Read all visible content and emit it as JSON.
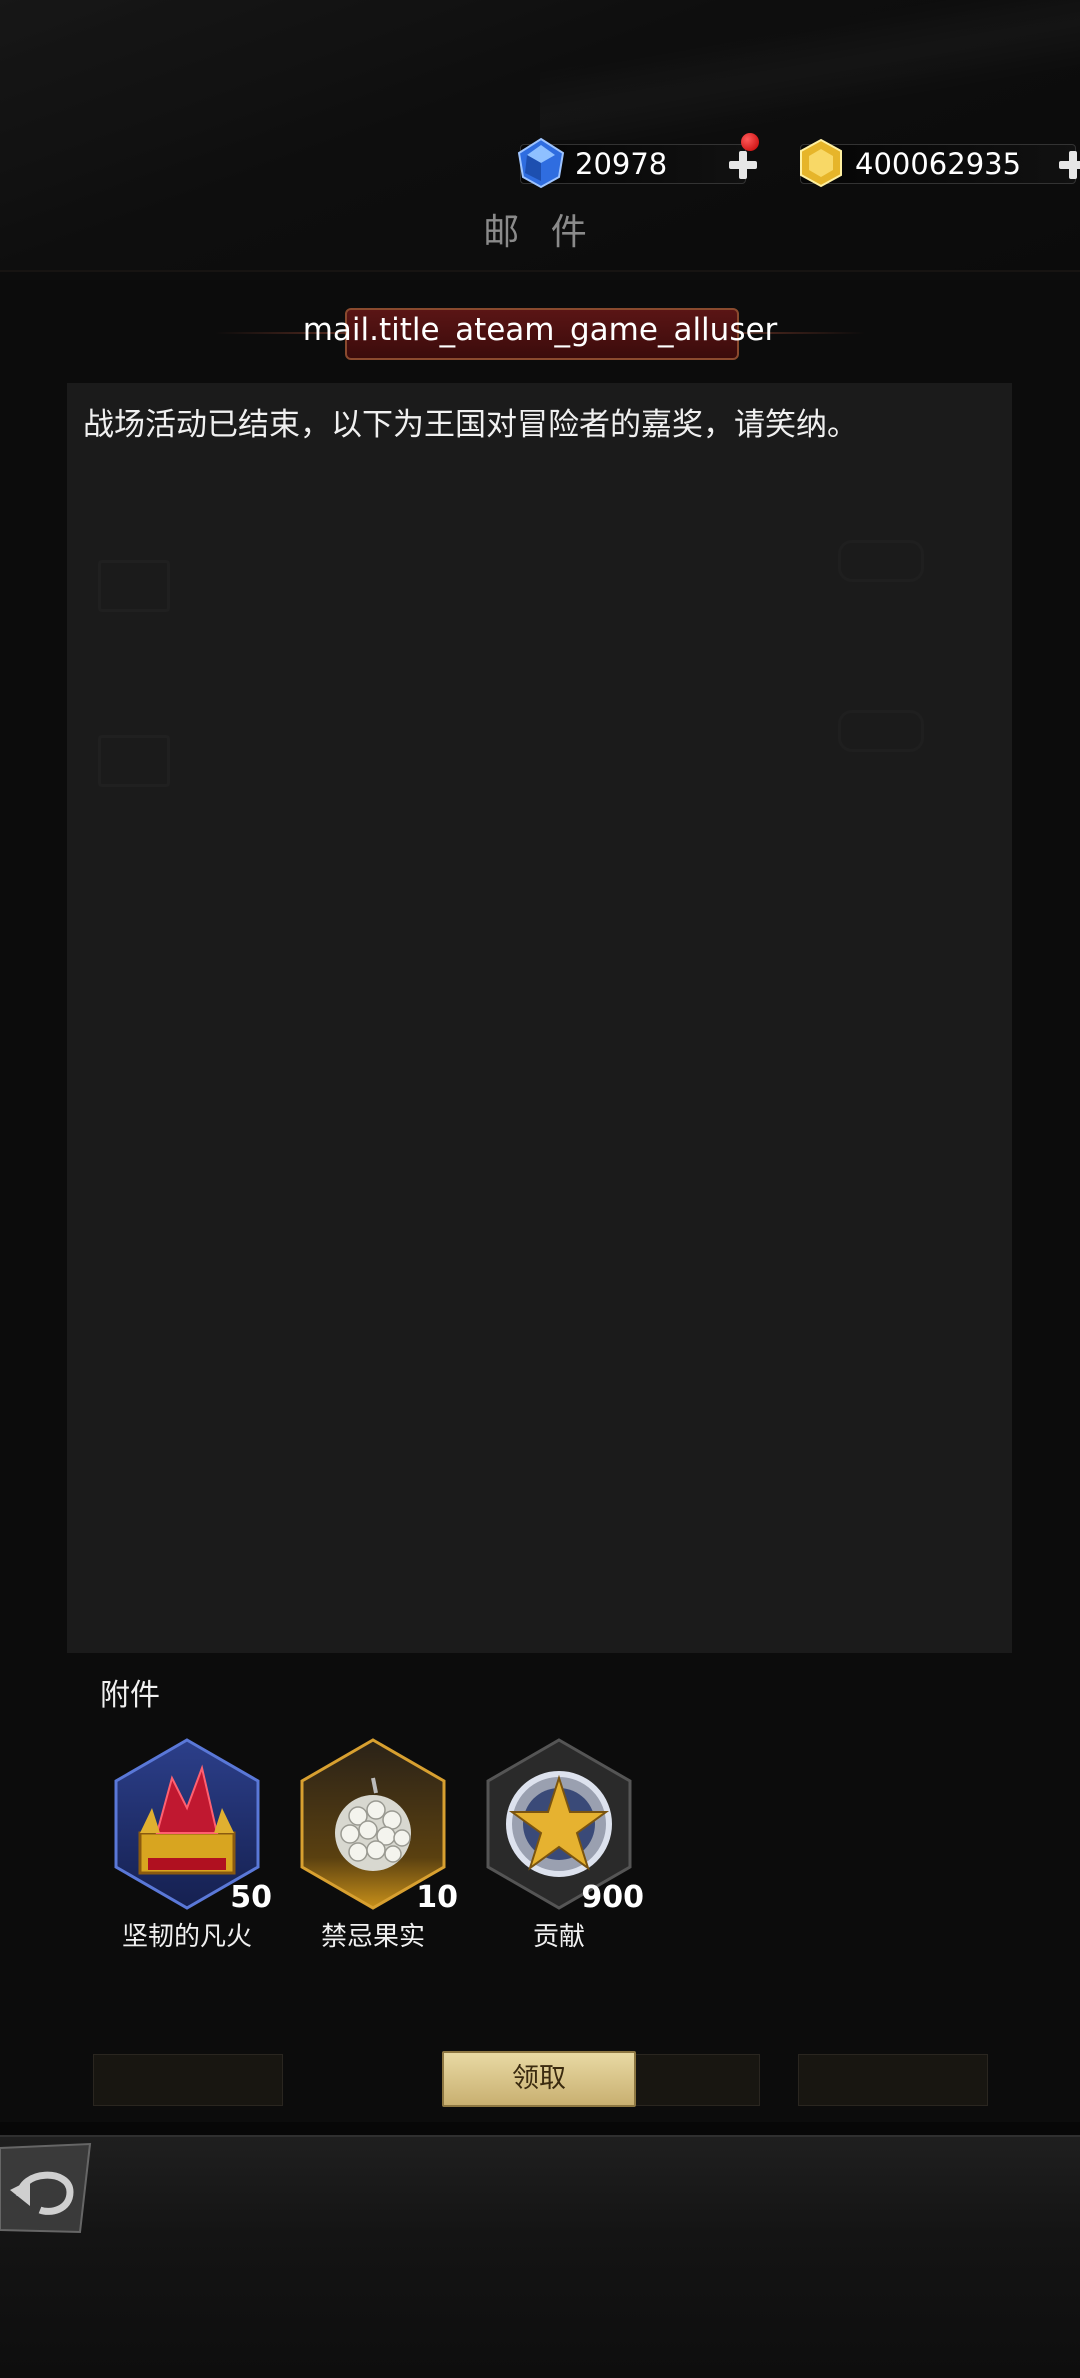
{
  "header": {
    "title": "邮 件",
    "currencies": [
      {
        "icon": "blue-diamond-icon",
        "value": "20978",
        "has_notification": true
      },
      {
        "icon": "gold-gem-icon",
        "value": "400062935",
        "has_notification": false
      }
    ]
  },
  "mail": {
    "title": "mail.title_ateam_game_alluser",
    "body": "战场活动已结束，以下为王国对冒险者的嘉奖，请笑纳。"
  },
  "attachments": {
    "label": "附件",
    "items": [
      {
        "icon": "red-crystal-chest-icon",
        "quantity": "50",
        "name": "坚韧的凡火"
      },
      {
        "icon": "white-fruit-icon",
        "quantity": "10",
        "name": "禁忌果实"
      },
      {
        "icon": "gold-star-medal-icon",
        "quantity": "900",
        "name": "贡献"
      }
    ]
  },
  "actions": {
    "claim_label": "领取"
  },
  "colors": {
    "panel_bg": "#1f1f1f",
    "claim_button": "#d9c48a",
    "title_plate": "#4a1010"
  }
}
